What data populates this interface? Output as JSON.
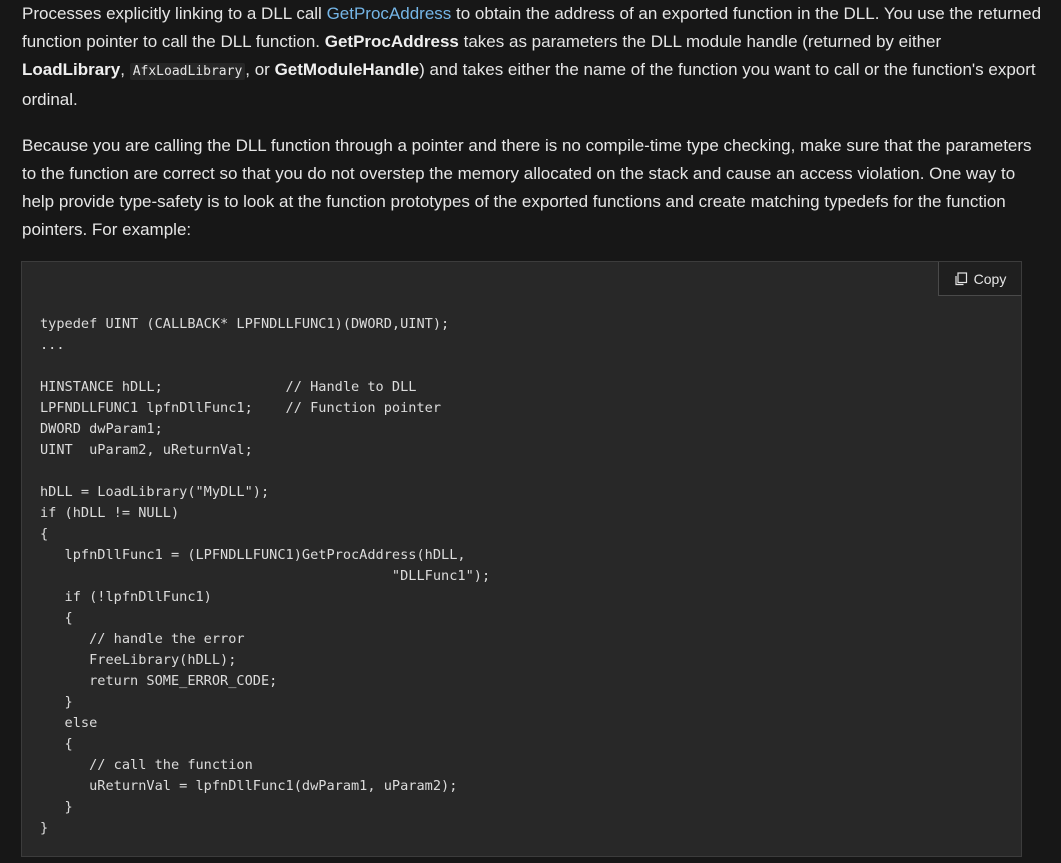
{
  "para1": {
    "t1": "Processes explicitly linking to a DLL call ",
    "link_getprocaddress": "GetProcAddress",
    "t2": " to obtain the address of an exported function in the DLL. You use the returned function pointer to call the DLL function. ",
    "strong_getprocaddress": "GetProcAddress",
    "t3": " takes as parameters the DLL module handle (returned by either ",
    "strong_loadlibrary": "LoadLibrary",
    "t4": ", ",
    "code_afxloadlibrary": "AfxLoadLibrary",
    "t5": ", or ",
    "strong_getmodulehandle": "GetModuleHandle",
    "t6": ") and takes either the name of the function you want to call or the function's export ordinal."
  },
  "para2": {
    "text": "Because you are calling the DLL function through a pointer and there is no compile-time type checking, make sure that the parameters to the function are correct so that you do not overstep the memory allocated on the stack and cause an access violation. One way to help provide type-safety is to look at the function prototypes of the exported functions and create matching typedefs for the function pointers. For example:"
  },
  "code_block": {
    "copy_label": "Copy",
    "copy_icon": "copy-icon",
    "code": "typedef UINT (CALLBACK* LPFNDLLFUNC1)(DWORD,UINT);\n...\n\nHINSTANCE hDLL;               // Handle to DLL\nLPFNDLLFUNC1 lpfnDllFunc1;    // Function pointer\nDWORD dwParam1;\nUINT  uParam2, uReturnVal;\n\nhDLL = LoadLibrary(\"MyDLL\");\nif (hDLL != NULL)\n{\n   lpfnDllFunc1 = (LPFNDLLFUNC1)GetProcAddress(hDLL,\n                                           \"DLLFunc1\");\n   if (!lpfnDllFunc1)\n   {\n      // handle the error\n      FreeLibrary(hDLL);\n      return SOME_ERROR_CODE;\n   }\n   else\n   {\n      // call the function\n      uReturnVal = lpfnDllFunc1(dwParam1, uParam2);\n   }\n}"
  },
  "colors": {
    "background": "#171717",
    "text": "#e6e6e6",
    "link": "#75b6e7",
    "code_bg": "#282828"
  }
}
